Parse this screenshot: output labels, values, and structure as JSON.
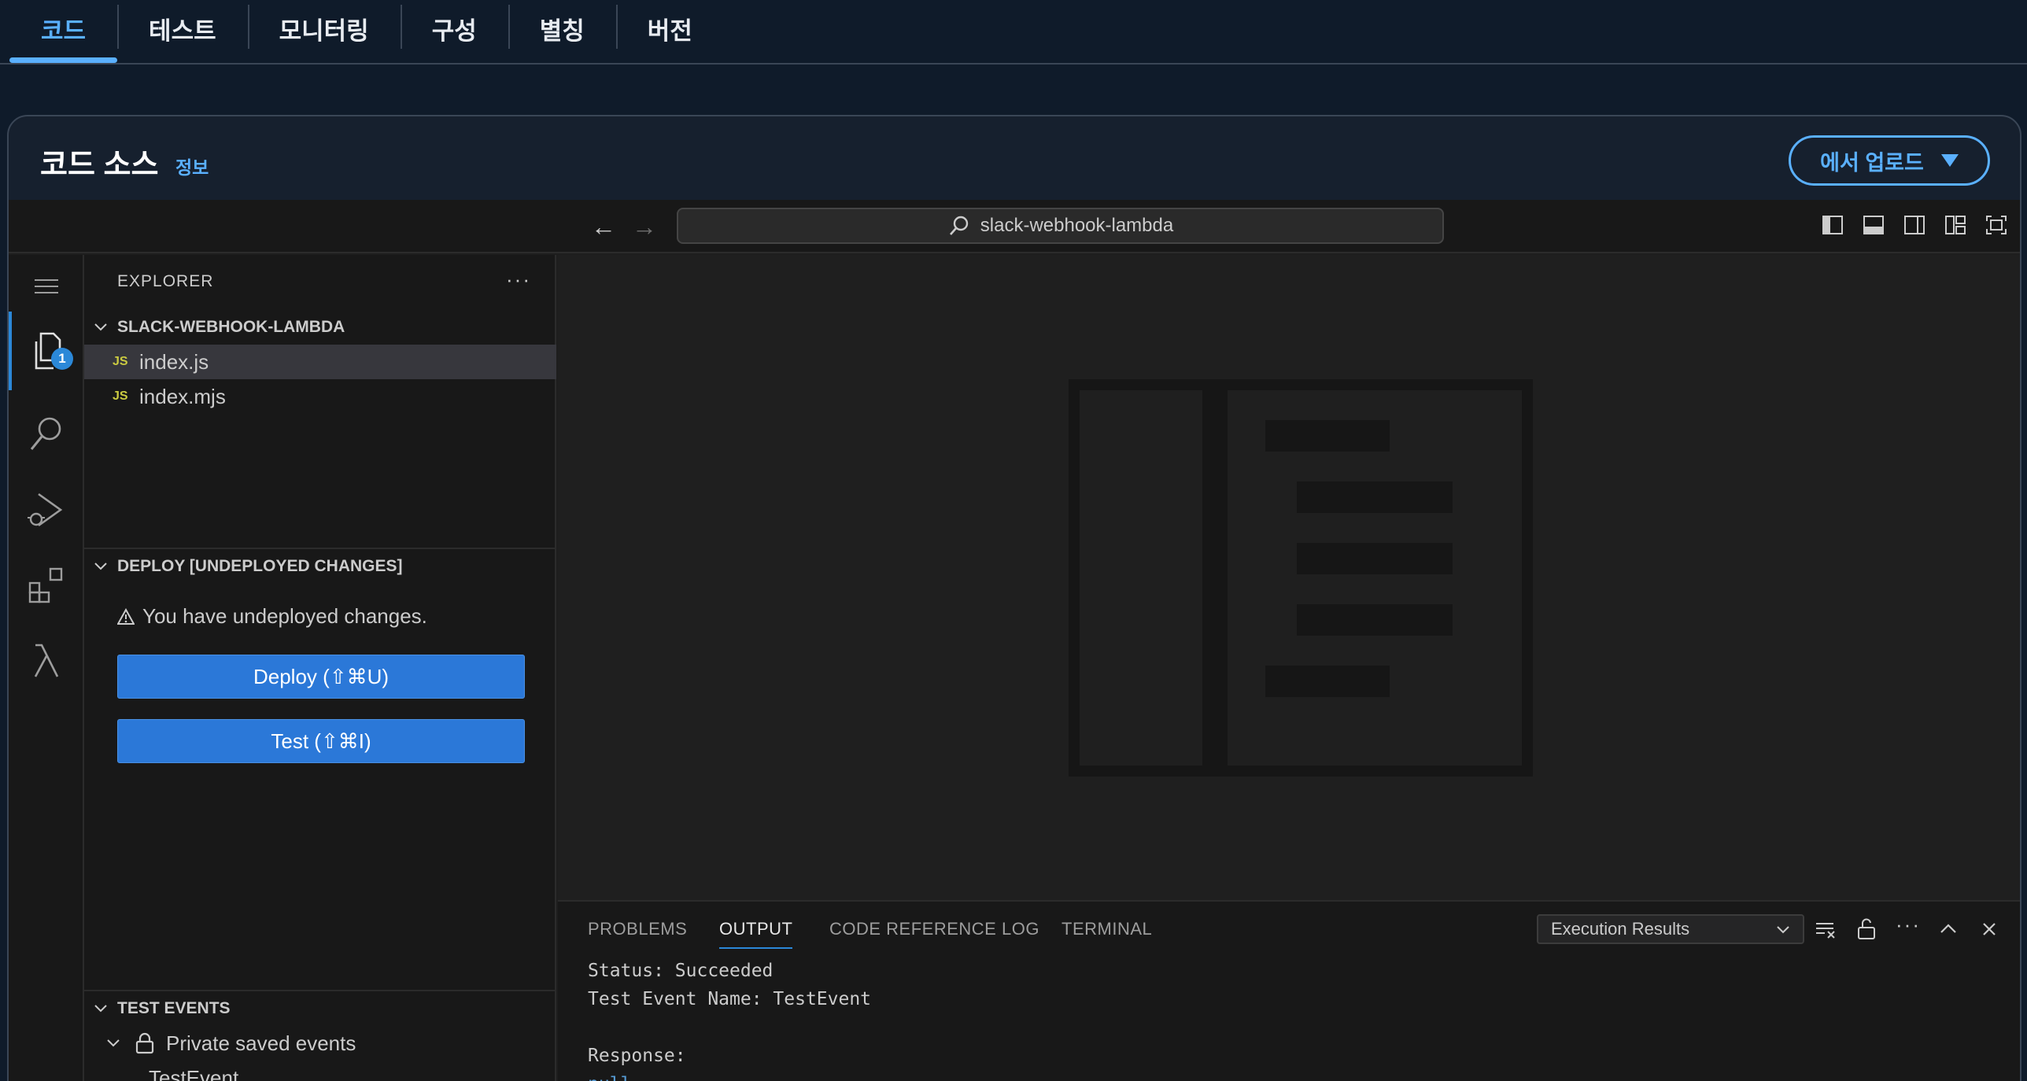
{
  "top_tabs": [
    {
      "label": "코드",
      "active": true
    },
    {
      "label": "테스트",
      "active": false
    },
    {
      "label": "모니터링",
      "active": false
    },
    {
      "label": "구성",
      "active": false
    },
    {
      "label": "별칭",
      "active": false
    },
    {
      "label": "버전",
      "active": false
    }
  ],
  "panel": {
    "title": "코드 소스",
    "info_link": "정보",
    "upload_button": "에서 업로드"
  },
  "titlebar": {
    "search_text": "slack-webhook-lambda"
  },
  "activity": {
    "explorer_badge": "1"
  },
  "explorer": {
    "title": "EXPLORER",
    "more": "···",
    "folder": "SLACK-WEBHOOK-LAMBDA",
    "files": [
      {
        "badge": "JS",
        "name": "index.js",
        "selected": true
      },
      {
        "badge": "JS",
        "name": "index.mjs",
        "selected": false
      }
    ]
  },
  "deploy": {
    "heading": "DEPLOY [UNDEPLOYED CHANGES]",
    "warning": "You have undeployed changes.",
    "deploy_button": "Deploy (⇧⌘U)",
    "test_button": "Test (⇧⌘I)"
  },
  "test_events": {
    "heading": "TEST EVENTS",
    "group": "Private saved events",
    "item": "TestEvent"
  },
  "bottom_panel": {
    "tabs": [
      "PROBLEMS",
      "OUTPUT",
      "CODE REFERENCE LOG",
      "TERMINAL"
    ],
    "active_tab": "OUTPUT",
    "selector": "Execution Results",
    "output": {
      "status": "Status: Succeeded",
      "event_name": "Test Event Name: TestEvent",
      "response_label": "Response:",
      "response_value": "null"
    }
  },
  "colors": {
    "accent": "#5ab0ff",
    "button_blue": "#2b78d8",
    "background": "#0f1b2a"
  }
}
